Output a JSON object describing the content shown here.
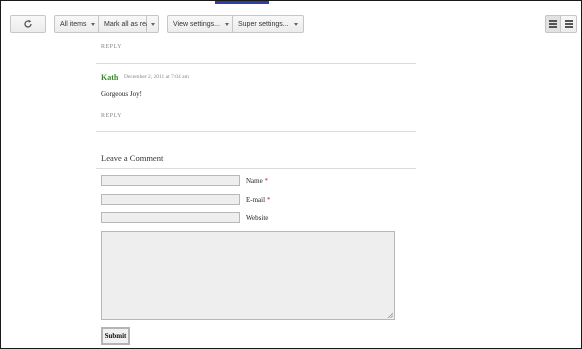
{
  "toolbar": {
    "refresh_icon": "refresh-icon",
    "all_items_label": "All items",
    "mark_all_read_label": "Mark all as read",
    "view_settings_label": "View settings...",
    "super_settings_label": "Super settings..."
  },
  "comments": {
    "reply_label": "REPLY",
    "items": [
      {
        "author": "Kath",
        "date": "December 2, 2011 at 7:04 am",
        "text": "Gorgeous Joy!",
        "reply_label": "REPLY"
      }
    ]
  },
  "comment_form": {
    "title": "Leave a Comment",
    "name_label": "Name",
    "email_label": "E-mail",
    "website_label": "Website",
    "required_mark": "*",
    "name_value": "",
    "email_value": "",
    "website_value": "",
    "submit_label": "Submit"
  },
  "colors": {
    "author": "#3a8a2b",
    "required": "#c81e1e",
    "accent_bar": "#2b3fa5"
  }
}
